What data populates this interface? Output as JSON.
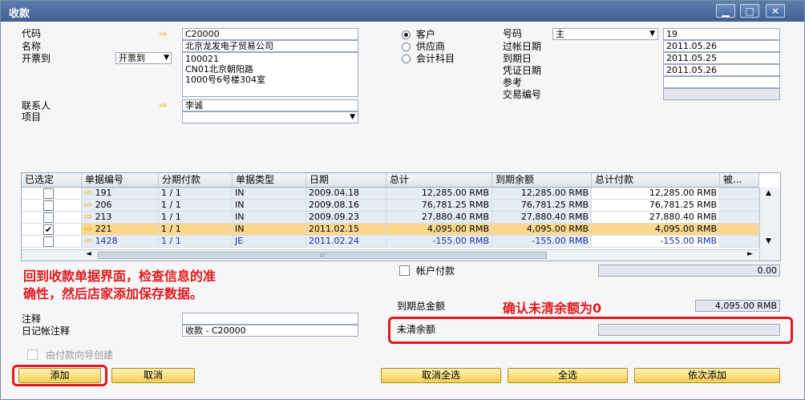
{
  "window": {
    "title": "收款",
    "minimize": "▁",
    "maximize": "□",
    "close": "✕"
  },
  "left": {
    "code_label": "代码",
    "code_value": "C20000",
    "name_label": "名称",
    "name_value": "北京龙发电子贸易公司",
    "billto_label": "开票到",
    "billto_select": "开票到",
    "address_lines": [
      "100021",
      "CN01北京朝阳路",
      "1000号6号楼304室"
    ],
    "contact_label": "联系人",
    "contact_value": "李诚",
    "project_label": "项目",
    "project_value": ""
  },
  "radios": [
    {
      "label": "客户",
      "selected": true
    },
    {
      "label": "供应商",
      "selected": false
    },
    {
      "label": "会计科目",
      "selected": false
    }
  ],
  "right": {
    "number_label": "号码",
    "series_value": "主",
    "number_value": "19",
    "posting_label": "过帐日期",
    "posting_value": "2011.05.26",
    "due_label": "到期日",
    "due_value": "2011.05.25",
    "doc_label": "凭证日期",
    "doc_value": "2011.05.26",
    "ref_label": "参考",
    "ref_value": "",
    "txn_label": "交易编号",
    "txn_value": ""
  },
  "table": {
    "columns": [
      "已选定",
      "单据编号",
      "分期付款",
      "单据类型",
      "日期",
      "总计",
      "到期余额",
      "总计付款",
      "被..."
    ],
    "rows": [
      {
        "checked": false,
        "doc": "191",
        "inst": "1 / 1",
        "type": "IN",
        "date": "2009.04.18",
        "total": "12,285.00 RMB",
        "due": "12,285.00 RMB",
        "pay": "12,285.00 RMB"
      },
      {
        "checked": false,
        "doc": "206",
        "inst": "1 / 1",
        "type": "IN",
        "date": "2009.08.16",
        "total": "76,781.25 RMB",
        "due": "76,781.25 RMB",
        "pay": "76,781.25 RMB"
      },
      {
        "checked": false,
        "doc": "213",
        "inst": "1 / 1",
        "type": "IN",
        "date": "2009.09.23",
        "total": "27,880.40 RMB",
        "due": "27,880.40 RMB",
        "pay": "27,880.40 RMB"
      },
      {
        "checked": true,
        "doc": "221",
        "inst": "1 / 1",
        "type": "IN",
        "date": "2011.02.15",
        "total": "4,095.00 RMB",
        "due": "4,095.00 RMB",
        "pay": "4,095.00 RMB"
      },
      {
        "checked": false,
        "doc": "1428",
        "inst": "1 / 1",
        "type": "JE",
        "date": "2011.02.24",
        "total": "-155.00 RMB",
        "due": "-155.00 RMB",
        "pay": "-155.00 RMB"
      }
    ],
    "scroll_up": "▲",
    "scroll_down": "▼",
    "scroll_left": "◄",
    "scroll_right": "►",
    "grip": ":::"
  },
  "annotation1": "回到收款单据界面，检查信息的准\n确性，然后店家添加保存数据。",
  "annotation2": "确认未清余额为0",
  "account_payment_label": "帐户付款",
  "account_payment_value": "0.00",
  "due_total_label": "到期总金额",
  "due_total_value": "4,095.00 RMB",
  "open_balance_label": "未清余额",
  "open_balance_value": "",
  "remarks_label": "注释",
  "remarks_value": "",
  "journal_label": "日记帐注释",
  "journal_value": "收款 - C20000",
  "wizard_label": "由付款向导创建",
  "buttons": {
    "add": "添加",
    "cancel": "取消",
    "deselect_all": "取消全选",
    "select_all": "全选",
    "add_in_sequence": "依次添加"
  },
  "icons": {
    "arrow": "⇨",
    "dropdown": "▼",
    "check": "✔"
  }
}
